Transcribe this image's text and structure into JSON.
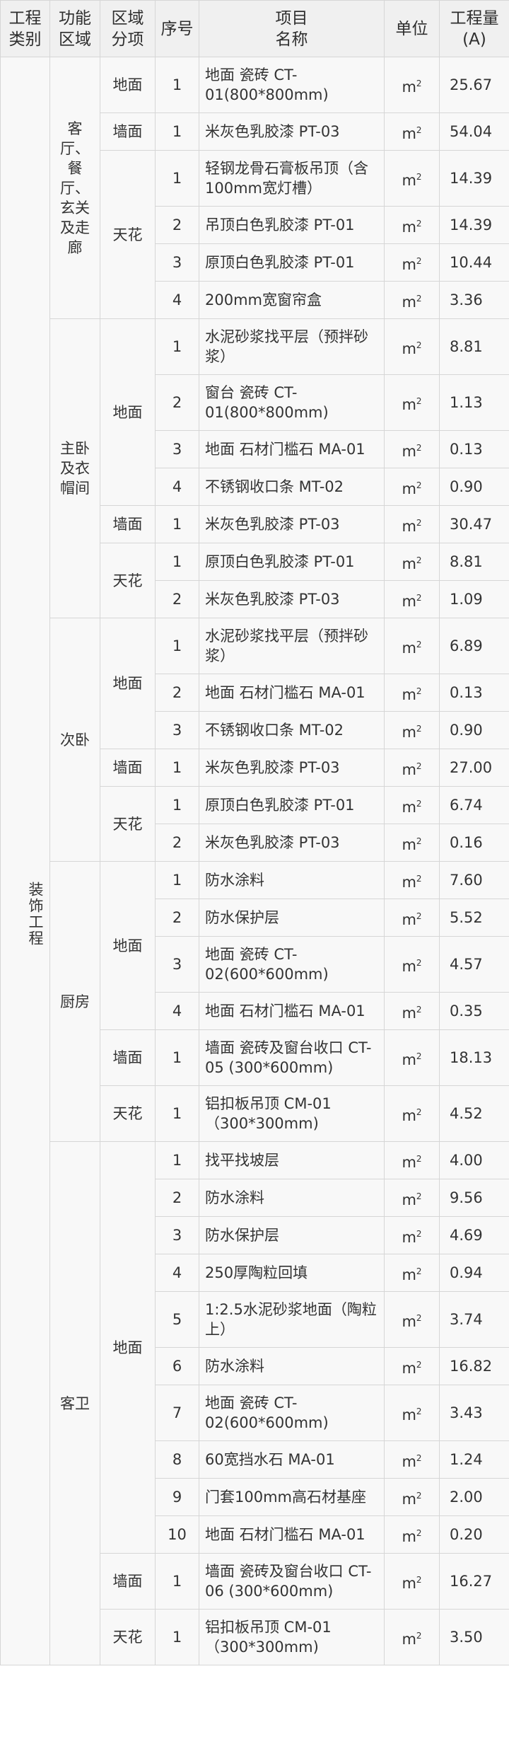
{
  "header": {
    "category": "工程\n类别",
    "function_area": "功能\n区域",
    "zone": "区域\n分项",
    "seq": "序号",
    "item_name": "项目\n名称",
    "unit": "单位",
    "quantity": "工程量\n(A)"
  },
  "unit_base": "m",
  "unit_sup": "2",
  "category_label": "装饰工程",
  "rows": [
    {
      "area": "客厅、餐厅、玄关及走廊",
      "zone": "地面",
      "seq": "1",
      "name": "地面 瓷砖 CT-01(800*800mm)",
      "qty": "25.67"
    },
    {
      "area": "",
      "zone": "墙面",
      "seq": "1",
      "name": "米灰色乳胶漆 PT-03",
      "qty": "54.04"
    },
    {
      "area": "",
      "zone": "天花",
      "seq": "1",
      "name": "轻钢龙骨石膏板吊顶（含100mm宽灯槽）",
      "qty": "14.39"
    },
    {
      "area": "",
      "zone": "",
      "seq": "2",
      "name": "吊顶白色乳胶漆 PT-01",
      "qty": "14.39"
    },
    {
      "area": "",
      "zone": "",
      "seq": "3",
      "name": "原顶白色乳胶漆 PT-01",
      "qty": "10.44"
    },
    {
      "area": "",
      "zone": "",
      "seq": "4",
      "name": "200mm宽窗帘盒",
      "qty": "3.36"
    },
    {
      "area": "主卧及衣帽间",
      "zone": "地面",
      "seq": "1",
      "name": "水泥砂浆找平层（预拌砂浆）",
      "qty": "8.81"
    },
    {
      "area": "",
      "zone": "",
      "seq": "2",
      "name": "窗台 瓷砖 CT-01(800*800mm)",
      "qty": "1.13"
    },
    {
      "area": "",
      "zone": "",
      "seq": "3",
      "name": "地面 石材门槛石 MA-01",
      "qty": "0.13"
    },
    {
      "area": "",
      "zone": "",
      "seq": "4",
      "name": "不锈钢收口条 MT-02",
      "qty": "0.90"
    },
    {
      "area": "",
      "zone": "墙面",
      "seq": "1",
      "name": "米灰色乳胶漆 PT-03",
      "qty": "30.47"
    },
    {
      "area": "",
      "zone": "天花",
      "seq": "1",
      "name": "原顶白色乳胶漆 PT-01",
      "qty": "8.81"
    },
    {
      "area": "",
      "zone": "",
      "seq": "2",
      "name": "米灰色乳胶漆 PT-03",
      "qty": "1.09"
    },
    {
      "area": "次卧",
      "zone": "地面",
      "seq": "1",
      "name": "水泥砂浆找平层（预拌砂浆）",
      "qty": "6.89"
    },
    {
      "area": "",
      "zone": "",
      "seq": "2",
      "name": "地面 石材门槛石 MA-01",
      "qty": "0.13"
    },
    {
      "area": "",
      "zone": "",
      "seq": "3",
      "name": "不锈钢收口条 MT-02",
      "qty": "0.90"
    },
    {
      "area": "",
      "zone": "墙面",
      "seq": "1",
      "name": "米灰色乳胶漆 PT-03",
      "qty": "27.00"
    },
    {
      "area": "",
      "zone": "天花",
      "seq": "1",
      "name": "原顶白色乳胶漆 PT-01",
      "qty": "6.74"
    },
    {
      "area": "",
      "zone": "",
      "seq": "2",
      "name": "米灰色乳胶漆 PT-03",
      "qty": "0.16"
    },
    {
      "area": "厨房",
      "zone": "地面",
      "seq": "1",
      "name": "防水涂料",
      "qty": "7.60"
    },
    {
      "area": "",
      "zone": "",
      "seq": "2",
      "name": "防水保护层",
      "qty": "5.52"
    },
    {
      "area": "",
      "zone": "",
      "seq": "3",
      "name": "地面 瓷砖 CT-02(600*600mm)",
      "qty": "4.57"
    },
    {
      "area": "",
      "zone": "",
      "seq": "4",
      "name": "地面 石材门槛石 MA-01",
      "qty": "0.35"
    },
    {
      "area": "",
      "zone": "墙面",
      "seq": "1",
      "name": "墙面 瓷砖及窗台收口 CT-05 (300*600mm)",
      "qty": "18.13"
    },
    {
      "area": "",
      "zone": "天花",
      "seq": "1",
      "name": "铝扣板吊顶 CM-01（300*300mm)",
      "qty": "4.52"
    },
    {
      "area": "客卫",
      "zone": "地面",
      "seq": "1",
      "name": "找平找坡层",
      "qty": "4.00"
    },
    {
      "area": "",
      "zone": "",
      "seq": "2",
      "name": "防水涂料",
      "qty": "9.56"
    },
    {
      "area": "",
      "zone": "",
      "seq": "3",
      "name": "防水保护层",
      "qty": "4.69"
    },
    {
      "area": "",
      "zone": "",
      "seq": "4",
      "name": "250厚陶粒回填",
      "qty": "0.94"
    },
    {
      "area": "",
      "zone": "",
      "seq": "5",
      "name": "1:2.5水泥砂浆地面（陶粒上）",
      "qty": "3.74"
    },
    {
      "area": "",
      "zone": "",
      "seq": "6",
      "name": "防水涂料",
      "qty": "16.82"
    },
    {
      "area": "",
      "zone": "",
      "seq": "7",
      "name": "地面 瓷砖 CT-02(600*600mm)",
      "qty": "3.43"
    },
    {
      "area": "",
      "zone": "",
      "seq": "8",
      "name": "60宽挡水石 MA-01",
      "qty": "1.24"
    },
    {
      "area": "",
      "zone": "",
      "seq": "9",
      "name": "门套100mm高石材基座",
      "qty": "2.00"
    },
    {
      "area": "",
      "zone": "",
      "seq": "10",
      "name": "地面 石材门槛石 MA-01",
      "qty": "0.20"
    },
    {
      "area": "",
      "zone": "墙面",
      "seq": "1",
      "name": "墙面 瓷砖及窗台收口 CT-06 (300*600mm)",
      "qty": "16.27"
    },
    {
      "area": "",
      "zone": "天花",
      "seq": "1",
      "name": "铝扣板吊顶 CM-01（300*300mm)",
      "qty": "3.50"
    }
  ]
}
